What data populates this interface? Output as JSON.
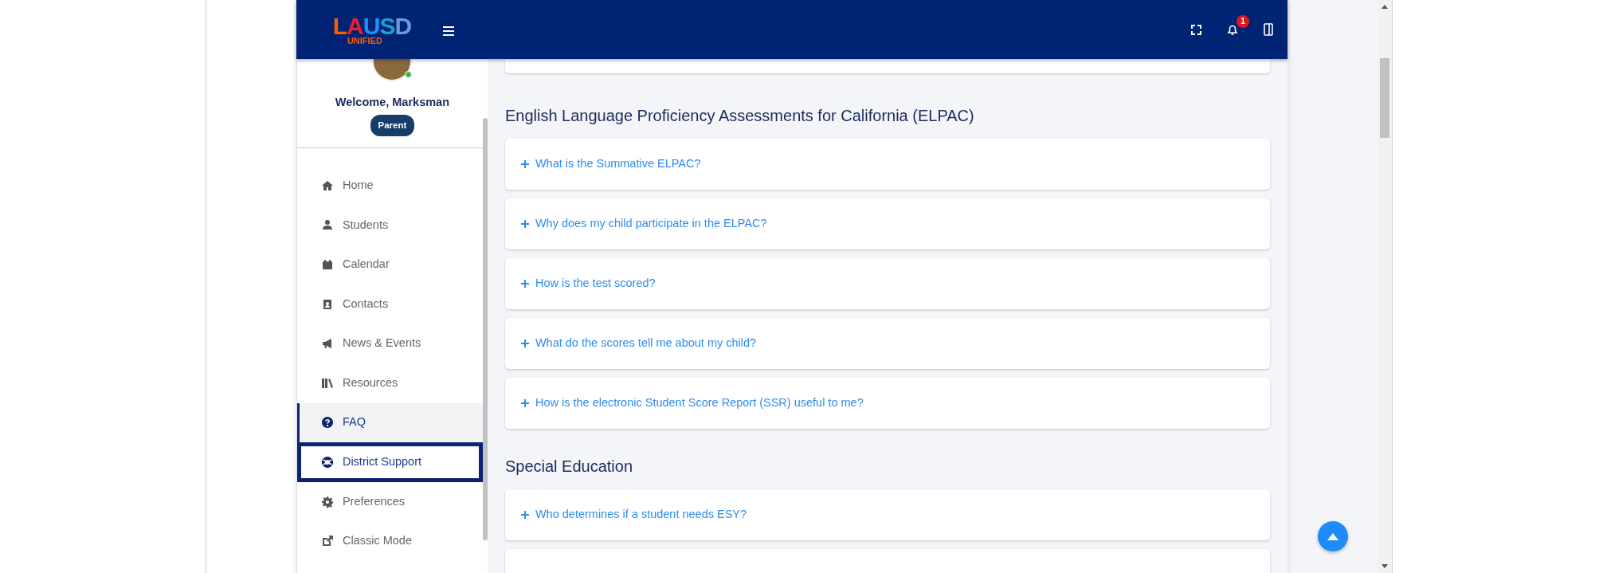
{
  "header": {
    "logo": {
      "text": "LAUSD",
      "subtext": "UNIFIED"
    },
    "notifications": "1"
  },
  "sidebar": {
    "user": {
      "welcome": "Welcome, Marksman",
      "role": "Parent",
      "online": true
    },
    "items": [
      {
        "label": "Home",
        "kind": "home",
        "selected": false,
        "focused": false
      },
      {
        "label": "Students",
        "kind": "user",
        "selected": false,
        "focused": false
      },
      {
        "label": "Calendar",
        "kind": "calendar",
        "selected": false,
        "focused": false
      },
      {
        "label": "Contacts",
        "kind": "contact",
        "selected": false,
        "focused": false
      },
      {
        "label": "News & Events",
        "kind": "megaphone",
        "selected": false,
        "focused": false
      },
      {
        "label": "Resources",
        "kind": "books",
        "selected": false,
        "focused": false
      },
      {
        "label": "FAQ",
        "kind": "question",
        "selected": true,
        "focused": false
      },
      {
        "label": "District Support",
        "kind": "lifering",
        "selected": false,
        "focused": true
      },
      {
        "label": "Preferences",
        "kind": "gear",
        "selected": false,
        "focused": false
      },
      {
        "label": "Classic Mode",
        "kind": "external",
        "selected": false,
        "focused": false
      }
    ]
  },
  "sections": [
    {
      "title": "English Language Proficiency Assessments for California (ELPAC)",
      "questions": [
        {
          "text": "What is the Summative ELPAC?",
          "expanded": false
        },
        {
          "text": "Why does my child participate in the ELPAC?",
          "expanded": false
        },
        {
          "text": "How is the test scored?",
          "expanded": false
        },
        {
          "text": "What do the scores tell me about my child?",
          "expanded": false
        },
        {
          "text": "How is the electronic Student Score Report (SSR) useful to me?",
          "expanded": false
        }
      ]
    },
    {
      "title": "Special Education",
      "questions": [
        {
          "text": "Who determines if a student needs ESY?",
          "expanded": false
        }
      ]
    }
  ]
}
